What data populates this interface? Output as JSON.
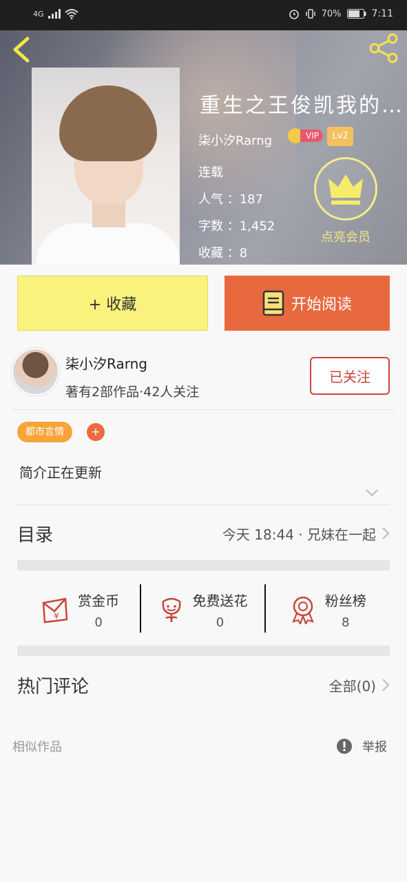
{
  "statusbar": {
    "network": "4G",
    "battery": "70%",
    "time": "7:11"
  },
  "book": {
    "title": "重生之王俊凯我的…",
    "author": "柒小汐Rarng",
    "vip_label": "VIP",
    "level": "Lv2",
    "status": "连载",
    "popularity": "人气 ：187",
    "words": "字数 ：1,452",
    "favorites": "收藏 ：8",
    "vip_action": "点亮会员"
  },
  "actions": {
    "favorite": "+ 收藏",
    "read": "开始阅读"
  },
  "author_card": {
    "name": "柒小汐Rarng",
    "stats": "著有2部作品·42人关注",
    "follow": "已关注"
  },
  "tags": {
    "items": [
      "都市言情"
    ],
    "add": "+"
  },
  "intro": {
    "text": "简介正在更新"
  },
  "catalog": {
    "label": "目录",
    "latest": "今天 18:44 · 兄妹在一起"
  },
  "rewards": [
    {
      "label": "赏金币",
      "value": "0"
    },
    {
      "label": "免费送花",
      "value": "0"
    },
    {
      "label": "粉丝榜",
      "value": "8"
    }
  ],
  "comments": {
    "label": "热门评论",
    "all": "全部(0)"
  },
  "footer": {
    "similar": "相似作品",
    "report": "举报"
  },
  "colors": {
    "accent_orange": "#e8693e",
    "accent_yellow": "#f9f27c",
    "follow_red": "#c9453a",
    "tag_orange": "#f7a539"
  }
}
